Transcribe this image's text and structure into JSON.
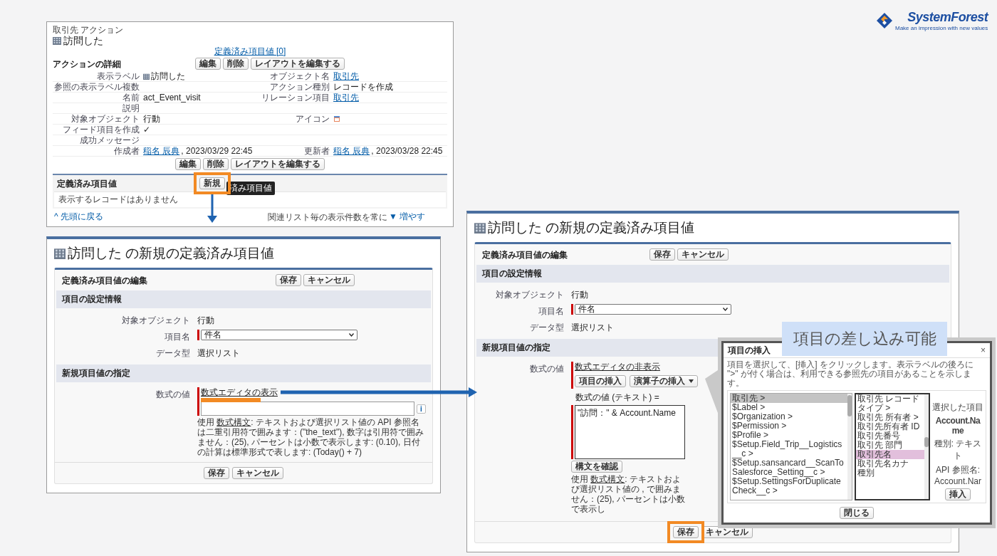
{
  "logo": {
    "name": "SystemForest",
    "tagline": "Make an impression with new values"
  },
  "detail_page": {
    "breadcrumb": "取引先 アクション",
    "title": "訪問した",
    "related_link": "定義済み項目値 [0]",
    "section_title": "アクションの詳細",
    "buttons": [
      "編集",
      "削除",
      "レイアウトを編集する"
    ],
    "rows": [
      {
        "left": {
          "label": "表示ラベル",
          "kind": "icon-text",
          "value": "訪問した"
        },
        "right": {
          "label": "オブジェクト名",
          "kind": "link",
          "value": "取引先"
        }
      },
      {
        "left": {
          "label": "参照の表示ラベル複数",
          "kind": "text"
        },
        "right": {
          "label": "アクション種別",
          "kind": "text",
          "value": "レコードを作成"
        }
      },
      {
        "left": {
          "label": "名前",
          "kind": "text",
          "value": "act_Event_visit"
        },
        "right": {
          "label": "リレーション項目",
          "kind": "link",
          "value": "取引先"
        }
      },
      {
        "left": {
          "label": "説明",
          "kind": "text"
        }
      },
      {
        "left": {
          "label": "対象オブジェクト",
          "kind": "text",
          "value": "行動"
        },
        "right": {
          "label": "アイコン",
          "kind": "icon"
        }
      },
      {
        "left": {
          "label": "フィード項目を作成",
          "kind": "text",
          "value": "✓"
        }
      },
      {
        "left": {
          "label": "成功メッセージ",
          "kind": "text"
        }
      },
      {
        "left": {
          "label": "作成者",
          "kind": "user-date",
          "user": "稲名 辰典",
          "value": ", 2023/03/29 22:45"
        },
        "right": {
          "label": "更新者",
          "kind": "user-date",
          "user": "稲名 辰典",
          "value": ", 2023/03/28 22:45"
        }
      }
    ],
    "bottom_buttons": [
      "編集",
      "削除",
      "レイアウトを編集する"
    ],
    "related_list": {
      "title": "定義済み項目値",
      "button": "新規",
      "tooltip": "済み項目値",
      "empty_message": "表示するレコードはありません"
    },
    "footer": {
      "back_link": "^ 先頭に戻る",
      "note": "関連リスト毎の表示件数を常に",
      "more_link": "▼ 増やす"
    }
  },
  "new_value_page": {
    "title": "訪問した の新規の定義済み項目値",
    "block_title": "定義済み項目値の編集",
    "buttons": [
      "保存",
      "キャンセル"
    ],
    "settings": {
      "title": "項目の設定情報",
      "rows": [
        {
          "label": "対象オブジェクト",
          "kind": "text",
          "value": "行動"
        },
        {
          "label": "項目名",
          "kind": "select",
          "value": "件名"
        },
        {
          "label": "データ型",
          "kind": "text",
          "value": "選択リスト"
        }
      ]
    },
    "value_section": {
      "kind": "simple",
      "title": "新規項目値の指定",
      "label": "数式の値",
      "editor_link": "数式エディタの表示",
      "info_button": "i",
      "helper": {
        "prefix": "使用",
        "link": "数式構文",
        "text": ": テキストおよび選択リスト値の API 参照名は二重引用符で囲みます：(\"the_text\"), 数字は引用符で囲みません：(25), パーセントは小数で表示します: (0.10), 日付の計算は標準形式で表します: (Today() + 7)"
      }
    },
    "bottom_buttons": [
      "保存",
      "キャンセル"
    ]
  },
  "editor_page": {
    "title": "訪問した の新規の定義済み項目値",
    "block_title": "定義済み項目値の編集",
    "buttons": [
      "保存",
      "キャンセル"
    ],
    "settings": {
      "title": "項目の設定情報",
      "rows": [
        {
          "label": "対象オブジェクト",
          "kind": "text",
          "value": "行動"
        },
        {
          "label": "項目名",
          "kind": "select",
          "value": "件名"
        },
        {
          "label": "データ型",
          "kind": "text",
          "value": "選択リスト"
        }
      ]
    },
    "value_section": {
      "kind": "editor",
      "title": "新規項目値の指定",
      "label": "数式の値",
      "editor_link": "数式エディタの非表示",
      "insert_buttons": [
        {
          "label": "項目の挿入",
          "kind": "button"
        },
        {
          "label": "演算子の挿入",
          "kind": "dropdown"
        }
      ],
      "formula_label": "数式の値 (テキスト) =",
      "formula": "\"訪問：\" & Account.Name",
      "check_button": "構文を確認",
      "helper": {
        "prefix": "使用",
        "link": "数式構文",
        "text": ": テキストおよび選択リスト値の , で囲みません：(25), パーセントは小数で表示し"
      }
    },
    "bottom_buttons": [
      "保存",
      "キャンセル"
    ]
  },
  "callout": "項目の差し込み可能",
  "insert_dialog": {
    "title": "項目の挿入",
    "close": "×",
    "description": "項目を選択して、[挿入] をクリックします。表示ラベルの後ろに \">\" が付く場合は、利用できる参照先の項目があることを示します。",
    "columns": [
      {
        "focused": false,
        "items": [
          {
            "label": "取引先 >",
            "selected": true
          },
          {
            "label": "$Label >",
            "selected": false
          },
          {
            "label": "$Organization >",
            "selected": false
          },
          {
            "label": "$Permission >",
            "selected": false
          },
          {
            "label": "$Profile >",
            "selected": false
          },
          {
            "label": "$Setup.Field_Trip__Logistics__c >",
            "selected": false
          },
          {
            "label": "$Setup.sansancard__ScanToSalesforce_Setting__c >",
            "selected": false
          },
          {
            "label": "$Setup.SettingsForDuplicateCheck__c >",
            "selected": false
          }
        ]
      },
      {
        "focused": true,
        "items": [
          {
            "label": "取引先 レコードタイプ >",
            "selected": false
          },
          {
            "label": "取引先 所有者 >",
            "selected": false
          },
          {
            "label": "取引先所有者 ID",
            "selected": false
          },
          {
            "label": "取引先番号",
            "selected": false
          },
          {
            "label": "取引先 部門",
            "selected": false
          },
          {
            "label": "取引先名",
            "selected": true
          },
          {
            "label": "取引先名カナ",
            "selected": false
          },
          {
            "label": "種別",
            "selected": false
          }
        ]
      }
    ],
    "selected_field": {
      "heading": "選択した項目",
      "name": "Account.Name",
      "type": "種別: テキスト",
      "api": "API 参照名: Account.Nar"
    },
    "insert_button": "挿入",
    "close_button": "閉じる"
  }
}
